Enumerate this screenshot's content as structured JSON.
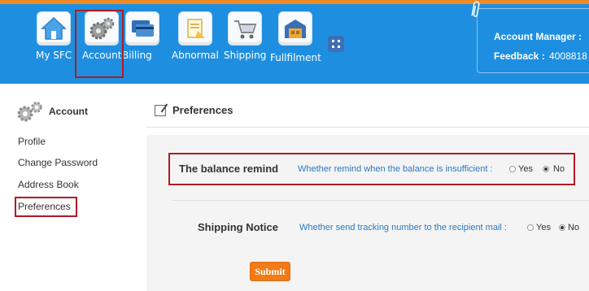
{
  "nav": {
    "items": [
      {
        "label": "My SFC",
        "icon": "home-icon"
      },
      {
        "label": "Account",
        "icon": "gear-icon"
      },
      {
        "label": "Billing",
        "icon": "credit-card-icon"
      },
      {
        "label": "Abnormal",
        "icon": "document-warning-icon"
      },
      {
        "label": "Shipping",
        "icon": "cart-icon"
      },
      {
        "label": "Fullfilment",
        "icon": "warehouse-icon"
      }
    ]
  },
  "header": {
    "account_manager_label": "Account Manager :",
    "feedback_label": "Feedback :",
    "feedback_value": "4008818"
  },
  "sidebar": {
    "title": "Account",
    "links": [
      "Profile",
      "Change Password",
      "Address Book",
      "Preferences"
    ]
  },
  "main": {
    "title": "Preferences",
    "balance": {
      "label": "The balance remind",
      "description": "Whether remind when the balance is insufficient :",
      "yes": "Yes",
      "no": "No",
      "selected": "No"
    },
    "shipping": {
      "label": "Shipping Notice",
      "description": "Whether send tracking number to the recipient mail :",
      "yes": "Yes",
      "no": "No",
      "selected": "No"
    },
    "submit_label": "Submit"
  },
  "colors": {
    "header_blue": "#1e8fe0",
    "accent_orange": "#f07b17",
    "highlight_red": "#b01b24",
    "link_blue": "#2a79c2"
  }
}
